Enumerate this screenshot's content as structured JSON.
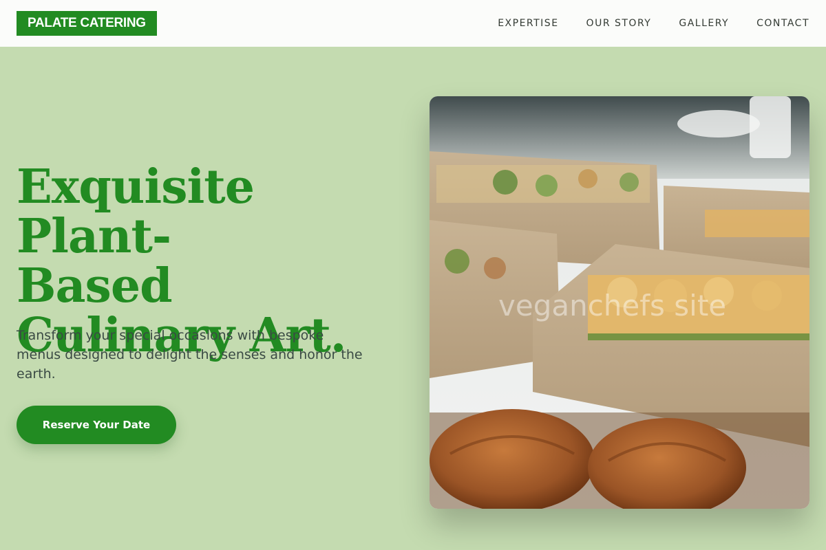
{
  "brand": {
    "name": "PALATE CATERING"
  },
  "nav": {
    "items": [
      {
        "label": "EXPERTISE"
      },
      {
        "label": "OUR STORY"
      },
      {
        "label": "GALLERY"
      },
      {
        "label": "CONTACT"
      }
    ]
  },
  "hero": {
    "title_lines": [
      "Exquisite Plant-",
      "Based",
      "Culinary Art."
    ],
    "subtitle": "Transform your special occasions with bespoke menus designed to delight the senses and honor the earth.",
    "cta_label": "Reserve Your Date",
    "image_watermark": "veganchefs site"
  },
  "colors": {
    "brand_green": "#228b22",
    "page_background": "#c4dbb0",
    "navbar_background": "#fbfcfa"
  }
}
